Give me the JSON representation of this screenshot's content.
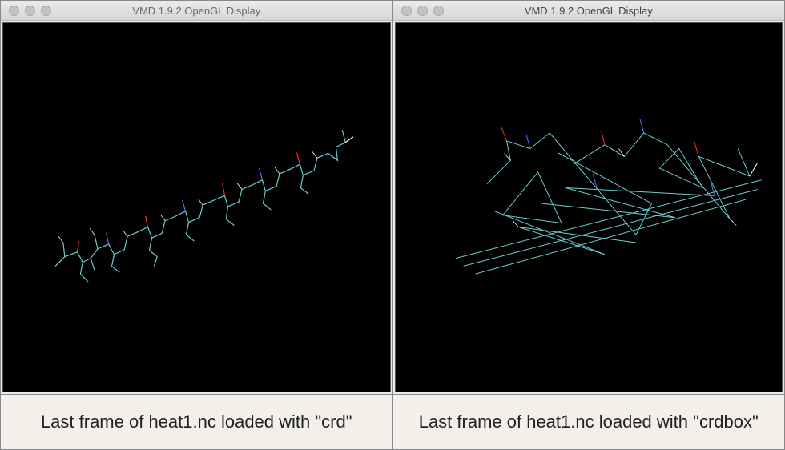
{
  "left": {
    "window_title": "VMD 1.9.2 OpenGL Display",
    "caption": "Last frame of heat1.nc loaded with \"crd\"",
    "active": false
  },
  "right": {
    "window_title": "VMD 1.9.2 OpenGL Display",
    "caption": "Last frame of heat1.nc loaded with \"crdbox\"",
    "active": true
  },
  "colors": {
    "carbon": "#6ed0d0",
    "oxygen": "#ff2d2d",
    "nitrogen": "#4a7aff",
    "hydrogen": "#ffffff",
    "background": "#000000"
  }
}
